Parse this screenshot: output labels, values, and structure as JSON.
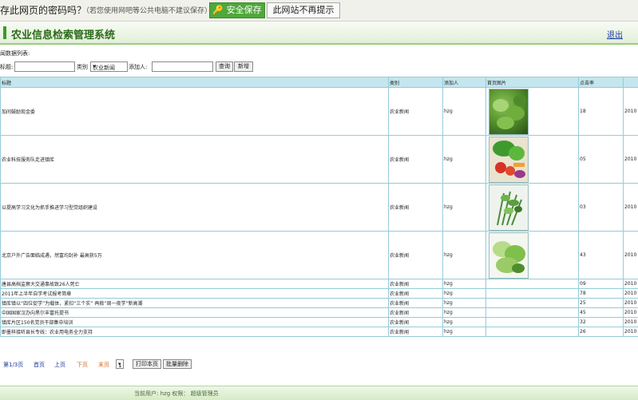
{
  "password_bar": {
    "question": "存此网页的密码吗？",
    "hint": "（若您使用网吧等公共电脑不建议保存）",
    "save_label": "安全保存",
    "never_label": "此网站不再提示"
  },
  "header": {
    "title": "农业信息检索管理系统",
    "logout": "退出"
  },
  "list_caption": "闻数据列表:",
  "search": {
    "title_label": "标题:",
    "title_value": "",
    "category_label": "类别",
    "category_selected": "农业新闻",
    "adder_label": "添加人:",
    "adder_value": "",
    "query_button": "查询",
    "add_button": "新增"
  },
  "table": {
    "headers": [
      "标题",
      "类别",
      "添加人",
      "首页图片",
      "点击率",
      ""
    ],
    "rows": [
      {
        "title": "加间鼓励现金委",
        "category": "农业新闻",
        "adder": "hzg",
        "image": "vegetable-photo-1",
        "clicks": "18",
        "date": "2010"
      },
      {
        "title": "农业科技服务队走进镇库",
        "category": "农业新闻",
        "adder": "hzg",
        "image": "vegetable-photo-2",
        "clicks": "05",
        "date": "2010"
      },
      {
        "title": "以提高学习文化为抓手推进学习型党组织建设",
        "category": "农业新闻",
        "adder": "hzg",
        "image": "vegetable-photo-3",
        "clicks": "03",
        "date": "2010"
      },
      {
        "title": "北京户外广告面临成遇，然富均封补 最高获5万",
        "category": "农业新闻",
        "adder": "hzg",
        "image": "vegetable-photo-4",
        "clicks": "43",
        "date": "2010"
      },
      {
        "title": "唐县高档监察大交通事故致26人死亡",
        "category": "农业新闻",
        "adder": "hzg",
        "image": "",
        "clicks": "09",
        "date": "2010"
      },
      {
        "title": "2011年上半年自学考试报考简章",
        "category": "农业新闻",
        "adder": "hzg",
        "image": "",
        "clicks": "78",
        "date": "2010"
      },
      {
        "title": "镇库镇以“四位促学”为载体，紧扣“三个实” 再掀“周一夜学”新高潮",
        "category": "农业新闻",
        "adder": "hzg",
        "image": "",
        "clicks": "25",
        "date": "2010"
      },
      {
        "title": "中国国家汉办向黑尔丰富托提书",
        "category": "农业新闻",
        "adder": "hzg",
        "image": "",
        "clicks": "45",
        "date": "2010"
      },
      {
        "title": "镇库片区150名党员干部集中培训",
        "category": "农业新闻",
        "adder": "hzg",
        "image": "",
        "clicks": "32",
        "date": "2010"
      },
      {
        "title": "即墨梓接听县长专线：农业用电务全力支持",
        "category": "农业新闻",
        "adder": "hzg",
        "image": "",
        "clicks": "26",
        "date": "2010"
      }
    ]
  },
  "pager": {
    "page_info": "第1/3页",
    "first": "首页",
    "prev": "上页",
    "next": "下页",
    "last": "末页",
    "page_select": "1",
    "print_button": "打印本页",
    "batch_delete_button": "批量删除"
  },
  "footer": {
    "status": "当前用户: hzg 权限： 超级管理员"
  },
  "colors": {
    "password_save_green": "#4fa83b",
    "title_green": "#2a6a1a",
    "table_header": "#c4e6ee",
    "table_border": "#95cbd8",
    "pager_orange": "#d2691e"
  }
}
